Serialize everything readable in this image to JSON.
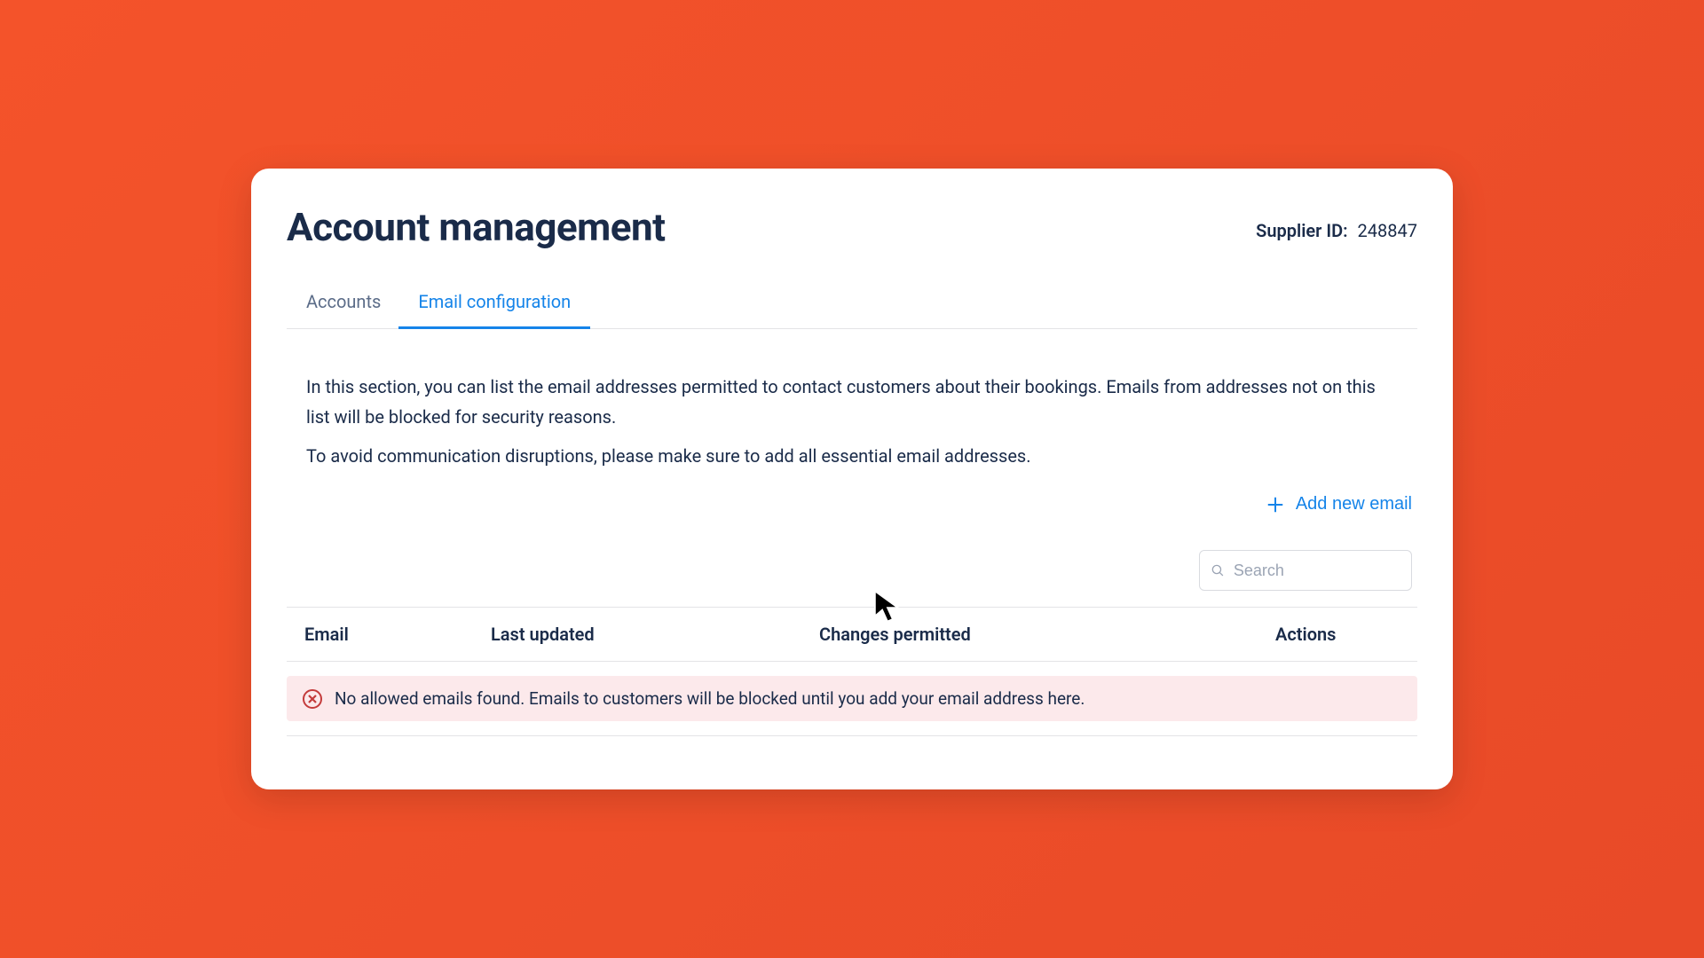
{
  "header": {
    "title": "Account management",
    "supplier_label": "Supplier ID:",
    "supplier_value": "248847"
  },
  "tabs": {
    "accounts": "Accounts",
    "email_config": "Email configuration"
  },
  "description": {
    "p1": "In this section, you can list the email addresses permitted to contact customers about their bookings. Emails from addresses not on this list will be blocked for security reasons.",
    "p2": "To avoid communication disruptions, please make sure to add all essential email addresses."
  },
  "actions": {
    "add_new_email": "Add new email"
  },
  "search": {
    "placeholder": "Search"
  },
  "table": {
    "headers": {
      "email": "Email",
      "last_updated": "Last updated",
      "changes_permitted": "Changes permitted",
      "actions": "Actions"
    }
  },
  "alert": {
    "message": "No allowed emails found. Emails to customers will be blocked until you add your email address here."
  }
}
